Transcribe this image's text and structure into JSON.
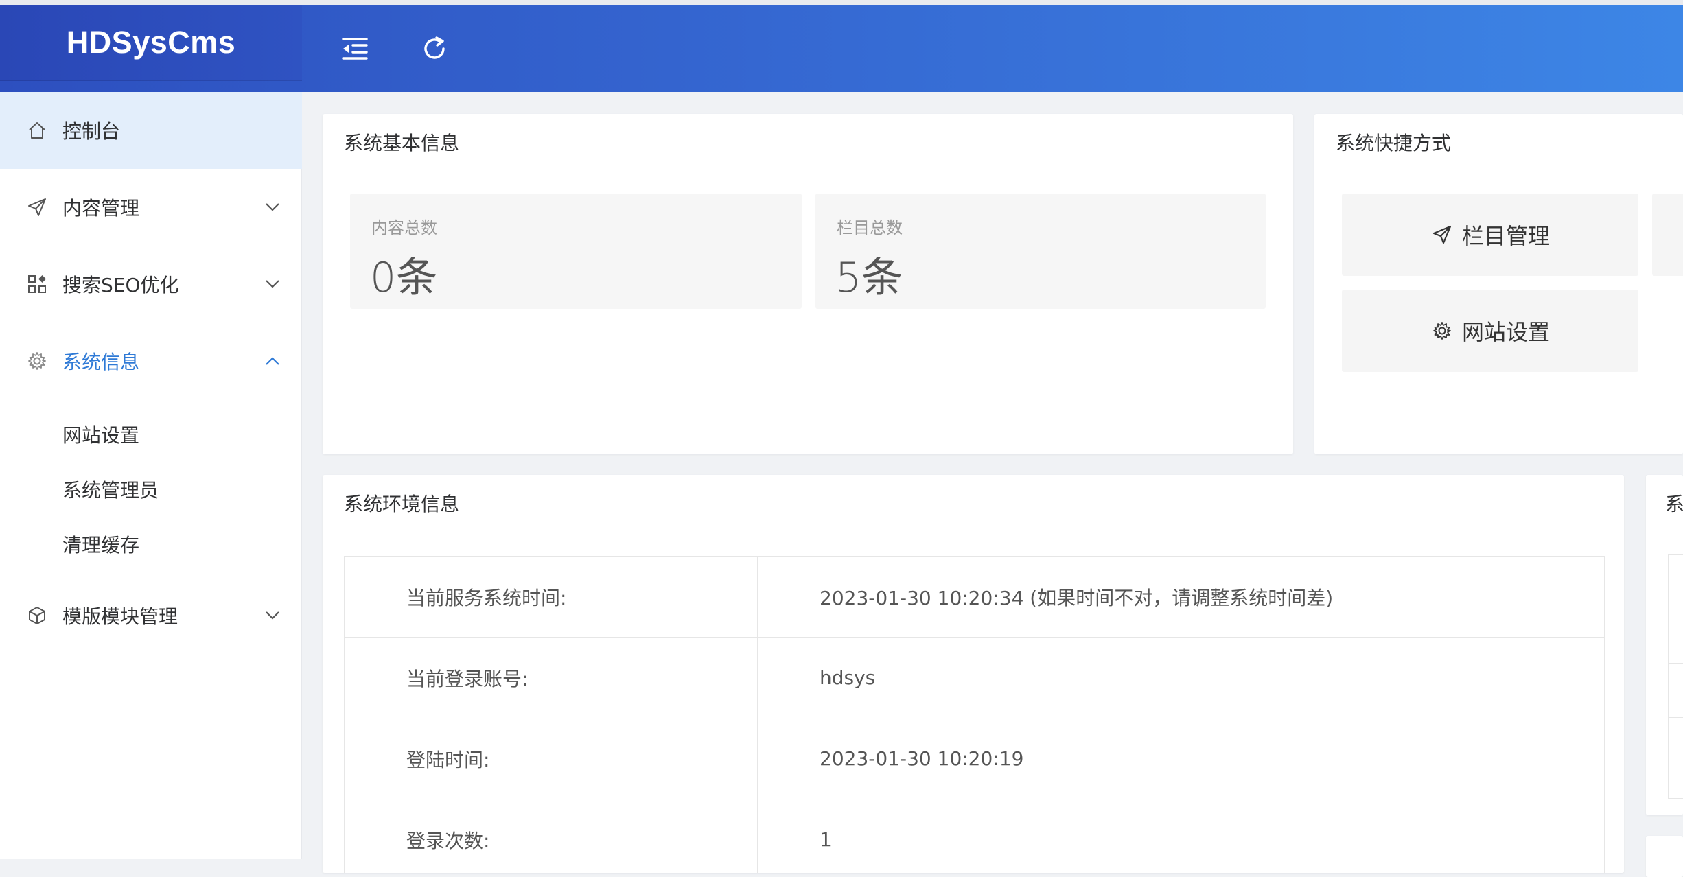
{
  "app": {
    "logo": "HDSysCms"
  },
  "header": {
    "icons": [
      "menu-fold-icon",
      "refresh-icon"
    ],
    "colors": {
      "gradient_start": "#2d4fbf",
      "gradient_end": "#3d86e6"
    }
  },
  "sidebar": {
    "items": [
      {
        "label": "控制台",
        "icon": "home-icon",
        "active": true
      },
      {
        "label": "内容管理",
        "icon": "send-icon",
        "expanded": false
      },
      {
        "label": "搜索SEO优化",
        "icon": "grid-icon",
        "expanded": false
      },
      {
        "label": "系统信息",
        "icon": "gear-icon",
        "expanded": true
      },
      {
        "label": "模版模块管理",
        "icon": "cube-icon",
        "expanded": false
      }
    ],
    "subitems": [
      "网站设置",
      "系统管理员",
      "清理缓存"
    ],
    "colors": {
      "active_bg": "#e3eefb",
      "open_text": "#2f7ad6"
    }
  },
  "basic_info": {
    "title": "系统基本信息",
    "stats": [
      {
        "label": "内容总数",
        "value": "0条"
      },
      {
        "label": "栏目总数",
        "value": "5条"
      }
    ]
  },
  "shortcuts": {
    "title": "系统快捷方式",
    "buttons": [
      {
        "label": "栏目管理",
        "icon": "send-icon"
      },
      {
        "label": "网站设置",
        "icon": "gear-icon"
      }
    ]
  },
  "env_info": {
    "title": "系统环境信息",
    "rows": [
      {
        "key": "当前服务系统时间:",
        "value": "2023-01-30 10:20:34 (如果时间不对，请调整系统时间差)"
      },
      {
        "key": "当前登录账号:",
        "value": "hdsys"
      },
      {
        "key": "登陆时间:",
        "value": "2023-01-30 10:20:19"
      },
      {
        "key": "登录次数:",
        "value": "1"
      }
    ]
  },
  "right_panel": {
    "title": "系"
  }
}
